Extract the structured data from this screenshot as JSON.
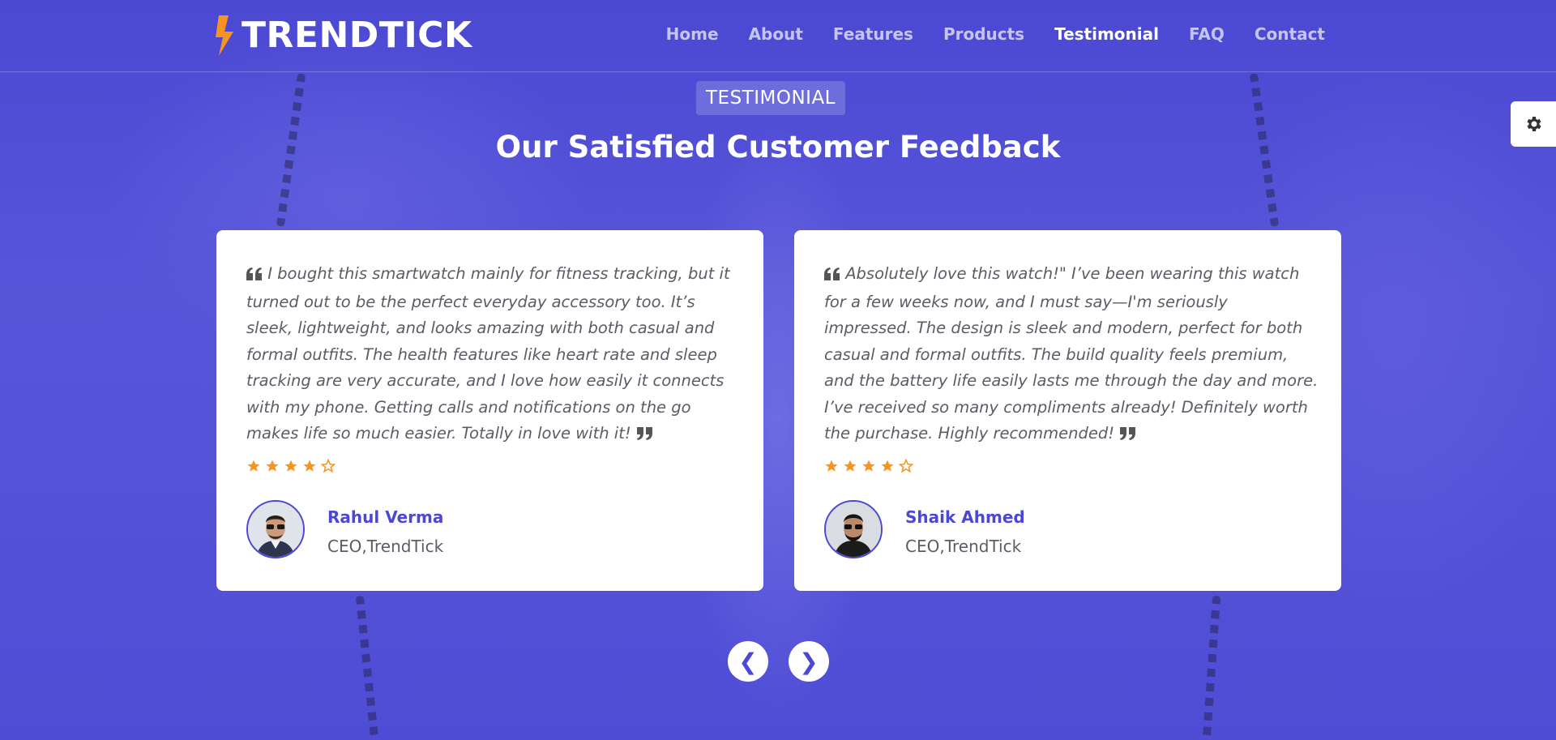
{
  "brand": {
    "name": "TRENDTICK",
    "accent": "#4a48d4",
    "logo_color": "#f7931e"
  },
  "nav": {
    "items": [
      {
        "label": "Home"
      },
      {
        "label": "About"
      },
      {
        "label": "Features"
      },
      {
        "label": "Products"
      },
      {
        "label": "Testimonial"
      },
      {
        "label": "FAQ"
      },
      {
        "label": "Contact"
      }
    ],
    "active": "Testimonial"
  },
  "settings": {
    "icon": "gear-icon"
  },
  "section": {
    "eyebrow": "TESTIMONIAL",
    "title": "Our Satisfied Customer Feedback"
  },
  "testimonials": [
    {
      "quote": "I bought this smartwatch mainly for fitness tracking, but it turned out to be the perfect everyday accessory too. It’s sleek, lightweight, and looks amazing with both casual and formal outfits. The health features like heart rate and sleep tracking are very accurate, and I love how easily it connects with my phone. Getting calls and notifications on the go makes life so much easier. Totally in love with it!",
      "rating": 4,
      "rating_max": 5,
      "name": "Rahul Verma",
      "role": "CEO,TrendTick"
    },
    {
      "quote": "Absolutely love this watch!\" I’ve been wearing this watch for a few weeks now, and I must say—I'm seriously impressed. The design is sleek and modern, perfect for both casual and formal outfits. The build quality feels premium, and the battery life easily lasts me through the day and more. I’ve received so many compliments already! Definitely worth the purchase. Highly recommended!",
      "rating": 4,
      "rating_max": 5,
      "name": "Shaik Ahmed",
      "role": "CEO,TrendTick"
    }
  ],
  "carousel": {
    "prev": "❮",
    "next": "❯"
  }
}
